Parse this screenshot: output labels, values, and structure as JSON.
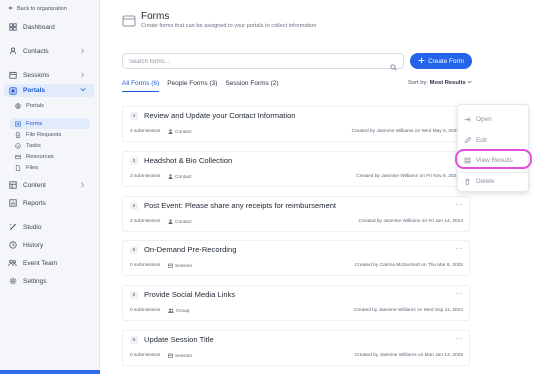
{
  "sidebar": {
    "back_link": "Back to organization",
    "items": [
      {
        "label": "Dashboard",
        "icon": "grid-icon"
      },
      {
        "label": "Contacts",
        "icon": "person-icon"
      },
      {
        "label": "Sessions",
        "icon": "calendar-icon"
      },
      {
        "label": "Portals",
        "icon": "portal-icon"
      },
      {
        "label": "Content",
        "icon": "content-icon"
      },
      {
        "label": "Reports",
        "icon": "chart-icon"
      },
      {
        "label": "Studio",
        "icon": "wand-icon"
      },
      {
        "label": "History",
        "icon": "history-icon"
      },
      {
        "label": "Event Team",
        "icon": "team-icon"
      },
      {
        "label": "Settings",
        "icon": "gear-icon"
      }
    ],
    "portal_subitems": [
      {
        "label": "Portals",
        "icon": "globe-icon"
      },
      {
        "label": "Forms",
        "icon": "form-icon"
      },
      {
        "label": "File Requests",
        "icon": "file-request-icon"
      },
      {
        "label": "Tasks",
        "icon": "check-circle-icon"
      },
      {
        "label": "Resources",
        "icon": "resources-icon"
      },
      {
        "label": "Files",
        "icon": "file-icon"
      }
    ]
  },
  "header": {
    "title": "Forms",
    "subtitle": "Create forms that can be assigned to your portals to collect information"
  },
  "search": {
    "placeholder": "Search forms..."
  },
  "create_button": {
    "label": "Create Form"
  },
  "tabs": [
    {
      "label": "All Forms (6)"
    },
    {
      "label": "People Forms (3)"
    },
    {
      "label": "Session Forms (2)"
    }
  ],
  "sort": {
    "label": "Sort by:",
    "value": "Most Results"
  },
  "forms": [
    {
      "number": "4",
      "title": "Review and Update your Contact Information",
      "submissions": "4 submissions",
      "type": "Contact",
      "created": "Created by Jasmine Williams on Wed May 6, 2025"
    },
    {
      "number": "3",
      "title": "Headshot & Bio Collection",
      "submissions": "3 submissions",
      "type": "Contact",
      "created": "Created by Jasmine Williams on Fri Nov 8, 2024"
    },
    {
      "number": "2",
      "title": "Post Event: Please share any receipts for reimbursement",
      "submissions": "2 submissions",
      "type": "Contact",
      "created": "Created by Jasmine Williams on Fri Jun 14, 2024"
    },
    {
      "number": "0",
      "title": "On-Demand Pre-Recording",
      "submissions": "0 submissions",
      "type": "Session",
      "created": "Created by Catrina McDermott on Thu Mar 6, 2025"
    },
    {
      "number": "0",
      "title": "Provide Social Media Links",
      "submissions": "0 submissions",
      "type": "Group",
      "created": "Created by Jasmine Williams on Wed Sep 11, 2024"
    },
    {
      "number": "0",
      "title": "Update Session Title",
      "submissions": "0 submissions",
      "type": "Session",
      "created": "Created by Jasmine Williams on Mon Jan 13, 2025"
    }
  ],
  "more_label": "...",
  "menu": {
    "items": [
      {
        "label": "Open",
        "icon": "open-icon"
      },
      {
        "label": "Edit",
        "icon": "pencil-icon"
      },
      {
        "label": "View Results",
        "icon": "table-icon"
      },
      {
        "label": "Delete",
        "icon": "trash-icon"
      }
    ]
  },
  "colors": {
    "accent": "#2563eb",
    "highlight": "#e14ee0",
    "sidebar_bg": "#f4f6f9"
  }
}
